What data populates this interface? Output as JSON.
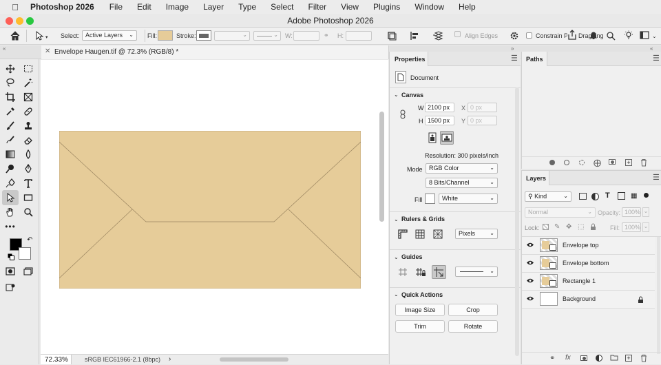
{
  "menubar": {
    "app_name": "Photoshop 2026",
    "items": [
      "File",
      "Edit",
      "Image",
      "Layer",
      "Type",
      "Select",
      "Filter",
      "View",
      "Plugins",
      "Window",
      "Help"
    ]
  },
  "window": {
    "title": "Adobe Photoshop 2026"
  },
  "options": {
    "select_label": "Select:",
    "select_value": "Active Layers",
    "fill_label": "Fill:",
    "fill_color": "#e6cc99",
    "stroke_label": "Stroke:",
    "w_label": "W:",
    "h_label": "H:",
    "align_edges": "Align Edges",
    "constrain": "Constrain Path Dragging"
  },
  "document": {
    "tab_title": "Envelope Haugen.tif @ 72.3% (RGB/8) *",
    "envelope_color": "#e6cc99",
    "zoom": "72.33%",
    "color_profile": "sRGB IEC61966-2.1 (8bpc)"
  },
  "properties": {
    "panel_title": "Properties",
    "document_label": "Document",
    "canvas": {
      "section": "Canvas",
      "w_label": "W",
      "w_value": "2100 px",
      "h_label": "H",
      "h_value": "1500 px",
      "x_label": "X",
      "x_placeholder": "0 px",
      "y_label": "Y",
      "y_placeholder": "0 px",
      "resolution": "Resolution: 300 pixels/inch",
      "mode_label": "Mode",
      "mode_value": "RGB Color",
      "bits_value": "8 Bits/Channel",
      "fill_label": "Fill",
      "fill_value": "White"
    },
    "rulers": {
      "section": "Rulers & Grids",
      "units": "Pixels"
    },
    "guides": {
      "section": "Guides"
    },
    "quick_actions": {
      "section": "Quick Actions",
      "image_size": "Image Size",
      "crop": "Crop",
      "trim": "Trim",
      "rotate": "Rotate"
    }
  },
  "paths": {
    "panel_title": "Paths"
  },
  "layers": {
    "panel_title": "Layers",
    "kind_filter": "Kind",
    "blend_mode": "Normal",
    "opacity_label": "Opacity:",
    "opacity_value": "100%",
    "lock_label": "Lock:",
    "fill_label": "Fill:",
    "fill_value": "100%",
    "items": [
      {
        "name": "Envelope top",
        "visible": true
      },
      {
        "name": "Envelope bottom",
        "visible": true
      },
      {
        "name": "Rectangle 1",
        "visible": true
      },
      {
        "name": "Background",
        "visible": true,
        "locked": true
      }
    ]
  }
}
